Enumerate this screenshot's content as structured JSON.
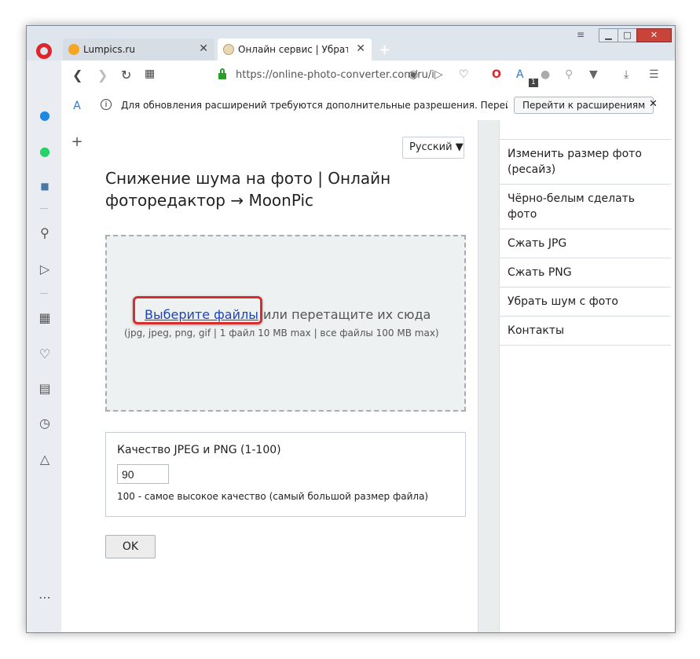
{
  "browser": {
    "tabs": [
      {
        "title": "Lumpics.ru",
        "close": "✕"
      },
      {
        "title": "Онлайн сервис | Убрать ш",
        "close": "✕"
      }
    ],
    "new_tab": "+",
    "address": "https://online-photo-converter.com/ru/i",
    "badge": "1",
    "window_controls": {
      "minimize": "▁",
      "maximize": "□",
      "close": "✕",
      "menu": "≡"
    }
  },
  "notification": {
    "info": "i",
    "message": "Для обновления расширений требуются дополнительные разрешения. Перейдите в ме...",
    "button": "Перейти к расширениям",
    "close": "✕"
  },
  "page": {
    "language": "Русский ▼",
    "title": "Снижение шума на фото | Онлайн фоторедактор → MoonPic",
    "upload": {
      "choose_link": "Выберите файлы",
      "drag_text": "или перетащите их сюда",
      "file_types": "(jpg, jpeg, png, gif | 1 файл 10 MB max | все файлы 100 MB max)"
    },
    "quality": {
      "label": "Качество JPEG и PNG (1-100)",
      "value": "90",
      "note": "100 - самое высокое качество (самый большой размер файла)"
    },
    "ok_button": "OK"
  },
  "right_nav": [
    "Изменить размер фото (ресайз)",
    "Чёрно-белым сделать фото",
    "Сжать JPG",
    "Сжать PNG",
    "Убрать шум с фото",
    "Контакты"
  ],
  "colors": {
    "opera_red": "#e0242b",
    "link": "#1a42c8",
    "highlight": "#d62e2e"
  }
}
